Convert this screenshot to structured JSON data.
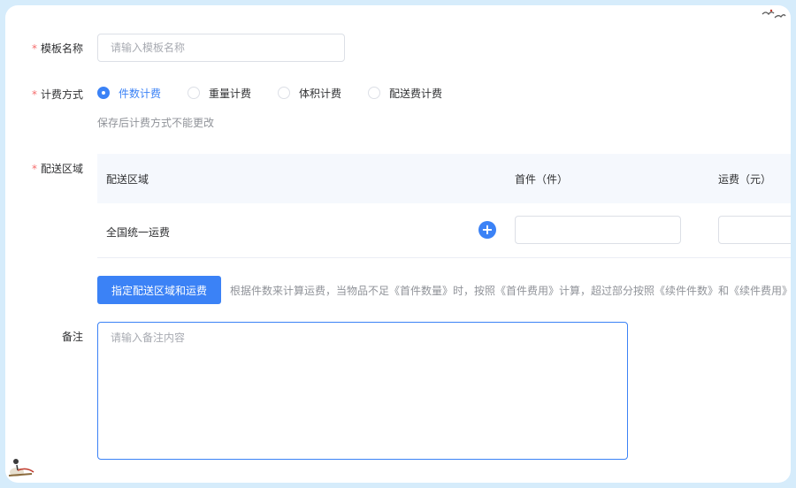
{
  "form": {
    "template_name": {
      "label": "模板名称",
      "required_mark": "*",
      "placeholder": "请输入模板名称",
      "value": ""
    },
    "billing_method": {
      "label": "计费方式",
      "required_mark": "*",
      "options": [
        {
          "label": "件数计费",
          "selected": true
        },
        {
          "label": "重量计费",
          "selected": false
        },
        {
          "label": "体积计费",
          "selected": false
        },
        {
          "label": "配送费计费",
          "selected": false
        }
      ],
      "hint": "保存后计费方式不能更改"
    },
    "delivery_area": {
      "label": "配送区域",
      "required_mark": "*",
      "table": {
        "headers": [
          "配送区域",
          "首件（件）",
          "运费（元）"
        ],
        "rows": [
          {
            "area": "全国统一运费",
            "first_item": "",
            "fee": ""
          }
        ]
      },
      "button_label": "指定配送区域和运费",
      "hint": "根据件数来计算运费，当物品不足《首件数量》时，按照《首件费用》计算，超过部分按照《续件件数》和《续件费用》"
    },
    "remark": {
      "label": "备注",
      "placeholder": "请输入备注内容",
      "value": ""
    }
  },
  "colors": {
    "primary": "#3b82f6",
    "required": "#f56c6c",
    "border": "#dcdfe6",
    "background": "#d6ecfb"
  },
  "icons": {
    "add": "plus-circle-icon",
    "decor_top_right": "birds-icon",
    "decor_bottom_left": "crane-icon"
  }
}
